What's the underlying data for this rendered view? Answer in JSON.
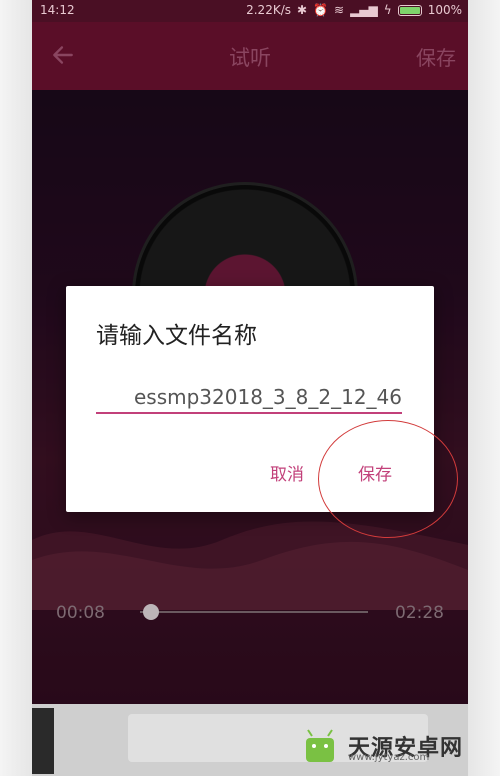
{
  "status_bar": {
    "time": "14:12",
    "network_speed": "2.22K/s",
    "battery": "100%",
    "icons": [
      "bluetooth-icon",
      "alarm-icon",
      "wifi-icon",
      "signal-icon",
      "charging-icon",
      "battery-icon"
    ]
  },
  "titlebar": {
    "back_icon": "arrow-left-icon",
    "title": "试听",
    "save_label": "保存"
  },
  "player": {
    "current_time": "00:08",
    "total_time": "02:28",
    "progress_fraction": 0.05
  },
  "dialog": {
    "title": "请输入文件名称",
    "filename_value": "essmp32018_3_8_2_12_46",
    "cancel_label": "取消",
    "save_label": "保存"
  },
  "watermark": {
    "name": "天源安卓网",
    "url": "www.jytyaz.com"
  },
  "colors": {
    "accent": "#c2407a",
    "titlebar": "#5a0e28",
    "annotation": "#d23b3b"
  }
}
